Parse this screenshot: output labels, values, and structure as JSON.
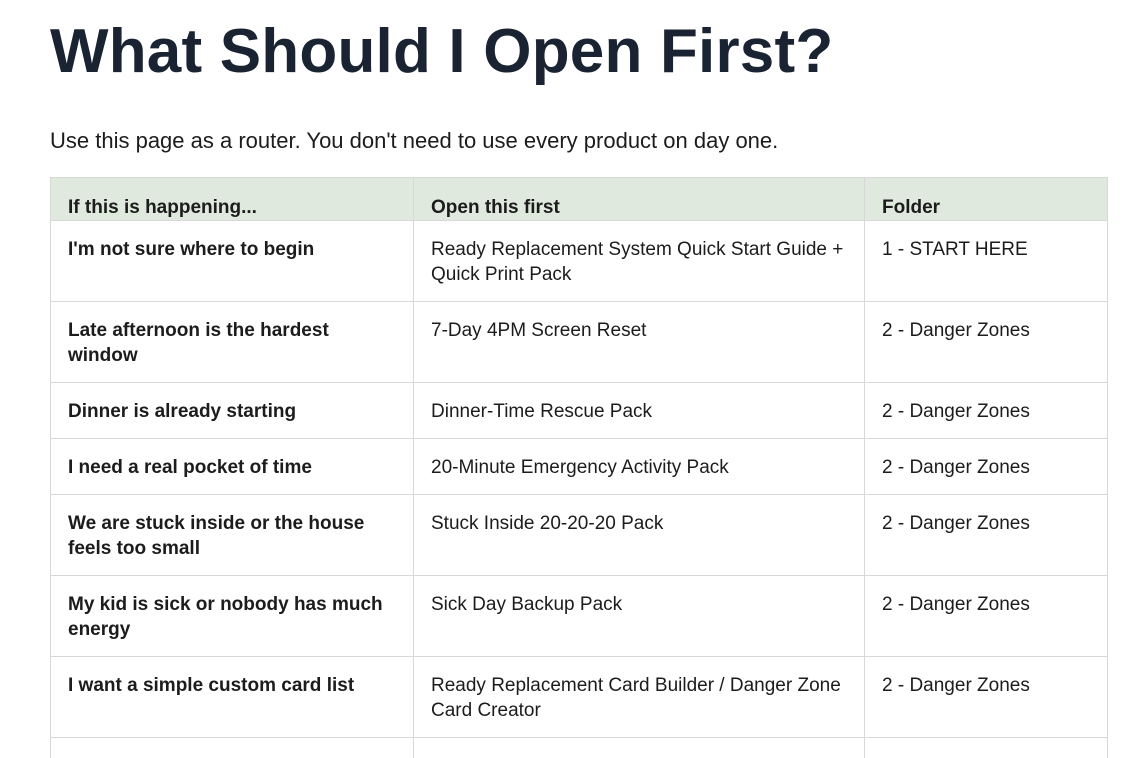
{
  "page": {
    "title": "What Should I Open First?",
    "intro": "Use this page as a router. You don't need to use every product on day one."
  },
  "table": {
    "headers": [
      "If this is happening...",
      "Open this first",
      "Folder"
    ],
    "rows": [
      {
        "situation": "I'm not sure where to begin",
        "open": "Ready Replacement System Quick Start Guide + Quick Print Pack",
        "folder": "1 - START HERE"
      },
      {
        "situation": "Late afternoon is the hardest window",
        "open": "7-Day 4PM Screen Reset",
        "folder": "2 - Danger Zones"
      },
      {
        "situation": "Dinner is already starting",
        "open": "Dinner-Time Rescue Pack",
        "folder": "2 - Danger Zones"
      },
      {
        "situation": "I need a real pocket of time",
        "open": "20-Minute Emergency Activity Pack",
        "folder": "2 - Danger Zones"
      },
      {
        "situation": "We are stuck inside or the house feels too small",
        "open": "Stuck Inside 20-20-20 Pack",
        "folder": "2 - Danger Zones"
      },
      {
        "situation": "My kid is sick or nobody has much energy",
        "open": "Sick Day Backup Pack",
        "folder": "2 - Danger Zones"
      },
      {
        "situation": "I want a simple custom card list",
        "open": "Ready Replacement Card Builder / Danger Zone Card Creator",
        "folder": "2 - Danger Zones"
      }
    ]
  }
}
